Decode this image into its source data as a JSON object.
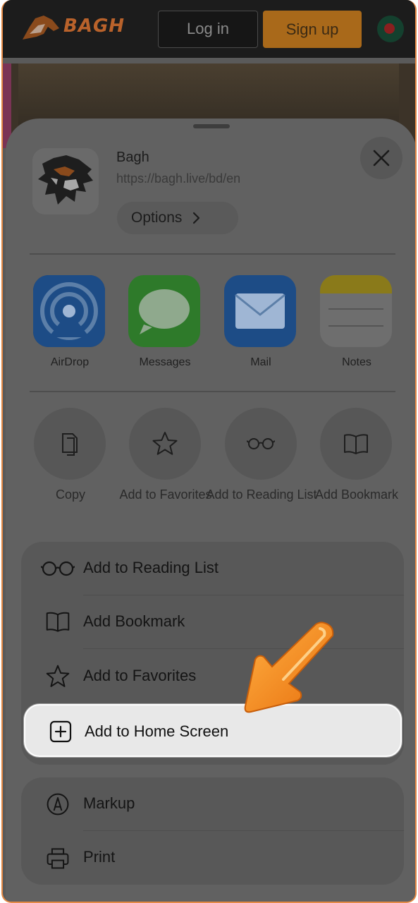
{
  "site": {
    "logo_text": "BAGH",
    "login_label": "Log in",
    "signup_label": "Sign up"
  },
  "sheet": {
    "title": "Bagh",
    "url": "https://bagh.live/bd/en",
    "options_label": "Options"
  },
  "share_apps": [
    {
      "label": "AirDrop",
      "icon": "airdrop-icon"
    },
    {
      "label": "Messages",
      "icon": "messages-icon"
    },
    {
      "label": "Mail",
      "icon": "mail-icon"
    },
    {
      "label": "Notes",
      "icon": "notes-icon"
    }
  ],
  "actions": [
    {
      "label": "Copy",
      "icon": "copy-icon"
    },
    {
      "label": "Add to Favorites",
      "icon": "star-icon"
    },
    {
      "label": "Add to Reading List",
      "icon": "glasses-icon"
    },
    {
      "label": "Add Bookmark",
      "icon": "book-icon"
    }
  ],
  "menu_group_1": [
    {
      "label": "Add to Reading List",
      "icon": "glasses-icon"
    },
    {
      "label": "Add Bookmark",
      "icon": "book-icon"
    },
    {
      "label": "Add to Favorites",
      "icon": "star-icon"
    },
    {
      "label": "Add to Home Screen",
      "icon": "plus-square-icon"
    }
  ],
  "menu_group_2": [
    {
      "label": "Markup",
      "icon": "markup-icon"
    },
    {
      "label": "Print",
      "icon": "printer-icon"
    }
  ],
  "colors": {
    "accent_orange": "#f28a22",
    "highlight_bg": "#e8e8e8",
    "sheet_bg": "#616161"
  }
}
